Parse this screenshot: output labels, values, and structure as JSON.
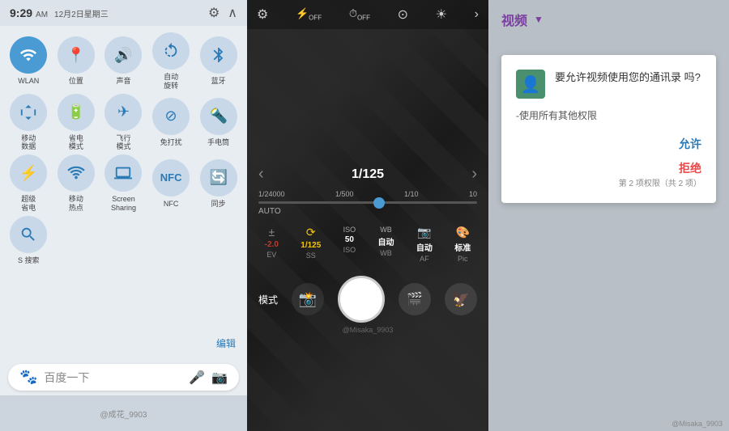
{
  "left": {
    "time": "9:29",
    "ampm": "AM",
    "date": "12月2日星期三",
    "gear_icon": "⚙",
    "chevron_icon": "∧",
    "edit_label": "编辑",
    "search_placeholder": "百度一下",
    "quick_settings": [
      {
        "id": "wlan",
        "icon": "📶",
        "label": "WLAN",
        "active": true
      },
      {
        "id": "location",
        "icon": "📍",
        "label": "位置",
        "active": false
      },
      {
        "id": "sound",
        "icon": "🔊",
        "label": "声音",
        "active": false
      },
      {
        "id": "rotate",
        "icon": "🔄",
        "label": "自动\n旋转",
        "active": false
      },
      {
        "id": "bluetooth",
        "icon": "🔷",
        "label": "蓝牙",
        "active": false
      },
      {
        "id": "data",
        "icon": "↑↓",
        "label": "移动\n数据",
        "active": false
      },
      {
        "id": "battery",
        "icon": "🔋",
        "label": "省电\n模式",
        "active": false
      },
      {
        "id": "airplane",
        "icon": "✈",
        "label": "飞行\n模式",
        "active": false
      },
      {
        "id": "noDisturb",
        "icon": "⊘",
        "label": "免打扰",
        "active": false
      },
      {
        "id": "phone",
        "icon": "📱",
        "label": "手电筒",
        "active": false
      },
      {
        "id": "superSave",
        "icon": "⚡",
        "label": "超级\n省电",
        "active": false
      },
      {
        "id": "hotspot",
        "icon": "📡",
        "label": "移动\n热点",
        "active": false
      },
      {
        "id": "screenShare",
        "icon": "🖥",
        "label": "Screen\nSharing",
        "active": false
      },
      {
        "id": "nfc",
        "icon": "N",
        "label": "NFC",
        "active": false
      },
      {
        "id": "sync",
        "icon": "🔄",
        "label": "同步",
        "active": false
      },
      {
        "id": "search",
        "icon": "🔍",
        "label": "S 搜索",
        "active": false
      }
    ],
    "watermark": "@成花_9903"
  },
  "middle": {
    "shutter_speed": "1/125",
    "shutter_min": "1/24000",
    "shutter_mid1": "1/500",
    "shutter_mid2": "1/10",
    "shutter_max": "10",
    "auto_label": "AUTO",
    "params": [
      {
        "icon": "±",
        "label": "EV",
        "value": "-2.0",
        "color": "red"
      },
      {
        "icon": "⟳",
        "label": "SS",
        "value": "1/125",
        "color": "yellow"
      },
      {
        "icon": "ISO",
        "label": "ISO",
        "value": "50",
        "color": "white"
      },
      {
        "icon": "WB",
        "label": "WB",
        "value": "自动",
        "color": "white"
      },
      {
        "icon": "📷",
        "label": "AF",
        "value": "自动",
        "color": "white"
      },
      {
        "icon": "🎨",
        "label": "Pic",
        "value": "标准",
        "color": "white"
      }
    ],
    "mode_label": "模式",
    "watermark": "@Misaka_9903"
  },
  "right": {
    "title": "视频",
    "dropdown": "▼",
    "dialog": {
      "icon": "👤",
      "title": "要允许视频使用您的通讯录\n吗?",
      "body": "-使用所有其他权限",
      "allow": "允许",
      "deny": "拒绝",
      "footer": "第 2 项权限（共 2 项）"
    },
    "watermark": "@Misaka_9903"
  }
}
